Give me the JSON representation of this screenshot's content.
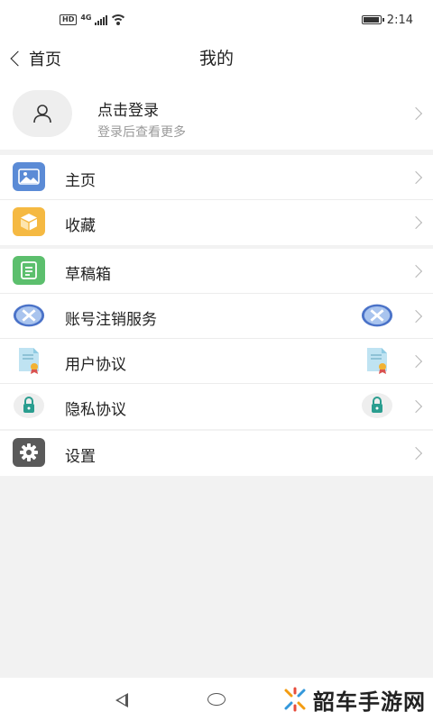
{
  "status_bar": {
    "network": "HD",
    "network_type": "4G",
    "time": "2:14",
    "battery_level": 0.95
  },
  "header": {
    "back_label": "首页",
    "title": "我的"
  },
  "profile": {
    "title": "点击登录",
    "subtitle": "登录后查看更多"
  },
  "menu": {
    "group1": [
      {
        "label": "主页",
        "icon": "image-icon",
        "color": "#5b8bd6"
      },
      {
        "label": "收藏",
        "icon": "box-icon",
        "color": "#f5b942"
      }
    ],
    "group2": [
      {
        "label": "草稿箱",
        "icon": "document-icon",
        "color": "#5cbf6d"
      },
      {
        "label": "账号注销服务",
        "icon": "close-circle-icon",
        "color": "#4a72c8"
      },
      {
        "label": "用户协议",
        "icon": "certificate-icon",
        "color": "#7ec8e3"
      },
      {
        "label": "隐私协议",
        "icon": "lock-icon",
        "color": "#2a9d8f"
      }
    ],
    "group3": [
      {
        "label": "设置",
        "icon": "gear-icon",
        "color": "#5a5a5a"
      }
    ]
  },
  "watermark": {
    "text": "韶车手游网"
  },
  "colors": {
    "background": "#f2f2f2",
    "card": "#ffffff",
    "chevron": "#b5b5b5",
    "subtext": "#9a9a9a"
  }
}
